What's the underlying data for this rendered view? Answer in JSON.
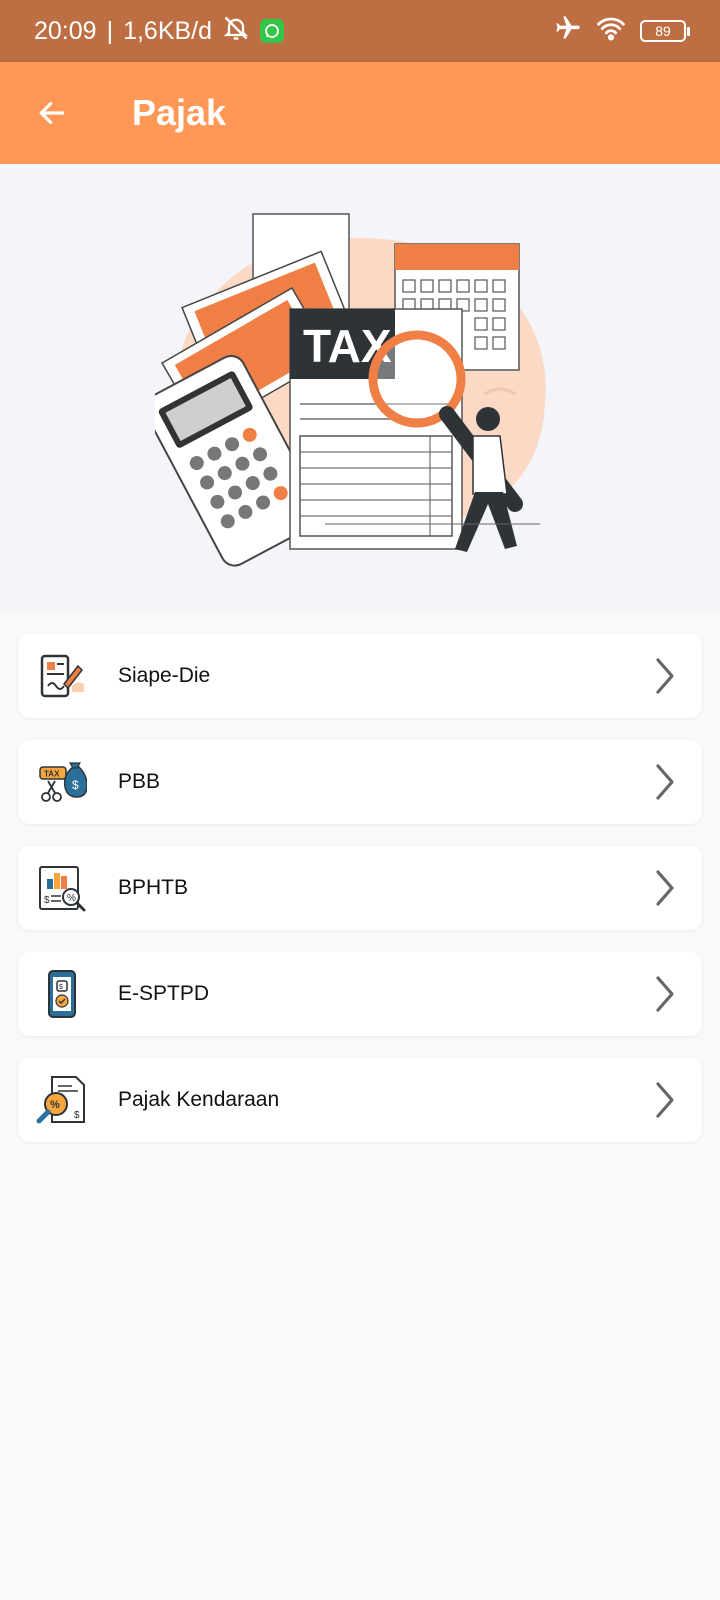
{
  "status_bar": {
    "time": "20:09",
    "separator": "|",
    "network_speed": "1,6KB/d",
    "battery": "89"
  },
  "app_bar": {
    "title": "Pajak"
  },
  "hero": {
    "tax_label": "TAX"
  },
  "menu": [
    {
      "label": "Siape-Die",
      "icon": "document-sign-icon"
    },
    {
      "label": "PBB",
      "icon": "tax-money-bag-icon"
    },
    {
      "label": "BPHTB",
      "icon": "tax-report-chart-icon"
    },
    {
      "label": "E-SPTPD",
      "icon": "mobile-tax-icon"
    },
    {
      "label": "Pajak Kendaraan",
      "icon": "tax-document-search-icon"
    }
  ],
  "colors": {
    "status_bar": "#bd6f43",
    "app_bar": "#ff9756",
    "accent": "#ef7f45",
    "dark": "#2e3338"
  }
}
